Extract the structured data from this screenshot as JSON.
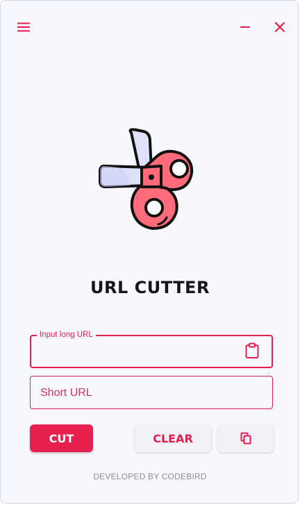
{
  "app": {
    "title": "URL CUTTER"
  },
  "titlebar": {
    "menu_icon": "hamburger-menu-icon",
    "minimize_icon": "minimize-icon",
    "close_icon": "close-icon"
  },
  "logo": {
    "icon": "scissors-icon"
  },
  "long_url": {
    "label": "Input long URL",
    "value": "",
    "paste_icon": "clipboard-paste-icon"
  },
  "short_url": {
    "placeholder": "Short URL",
    "value": ""
  },
  "buttons": {
    "cut_label": "CUT",
    "clear_label": "CLEAR",
    "copy_icon": "copy-icon"
  },
  "footer": {
    "text": "DEVELOPED BY CODEBIRD"
  },
  "colors": {
    "accent": "#e41d50",
    "background": "#f7f8fd",
    "title_text": "#15161c",
    "footer_text": "#8c8c96",
    "scissor_handle": "#ff6b7a",
    "scissor_blade": "#dfe1fa"
  }
}
